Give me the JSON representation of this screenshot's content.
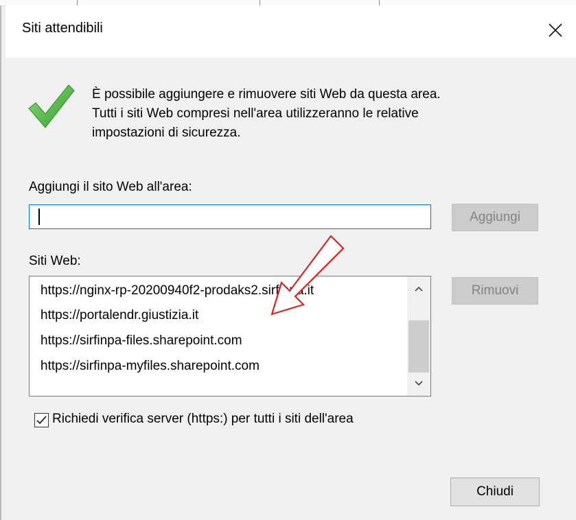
{
  "window": {
    "title": "Siti attendibili",
    "close_glyph": "✕"
  },
  "header": {
    "icon": "green-checkmark-icon",
    "description_lines": [
      "È possibile aggiungere e rimuovere siti Web da questa area.",
      "Tutti i siti Web compresi nell'area utilizzeranno le relative",
      "impostazioni di sicurezza."
    ]
  },
  "add_site": {
    "label": "Aggiungi il sito Web all'area:",
    "value": "",
    "placeholder": "",
    "button_label": "Aggiungi",
    "button_enabled": false
  },
  "sites": {
    "label": "Siti Web:",
    "items": [
      "https://nginx-rp-20200940f2-prodaks2.sirfinpa.it",
      "https://portalendr.giustizia.it",
      "https://sirfinpa-files.sharepoint.com",
      "https://sirfinpa-myfiles.sharepoint.com"
    ],
    "remove_label": "Rimuovi",
    "remove_enabled": false
  },
  "https_check": {
    "label": "Richiedi verifica server (https:) per tutti i siti dell'area",
    "checked": true
  },
  "footer": {
    "close_label": "Chiudi"
  },
  "annotation": {
    "arrow_color": "#e02020",
    "arrow_icon": "red-arrow-icon"
  },
  "colors": {
    "accent": "#0078d7",
    "check_green": "#4cbb3a",
    "disabled_text": "#838383"
  }
}
